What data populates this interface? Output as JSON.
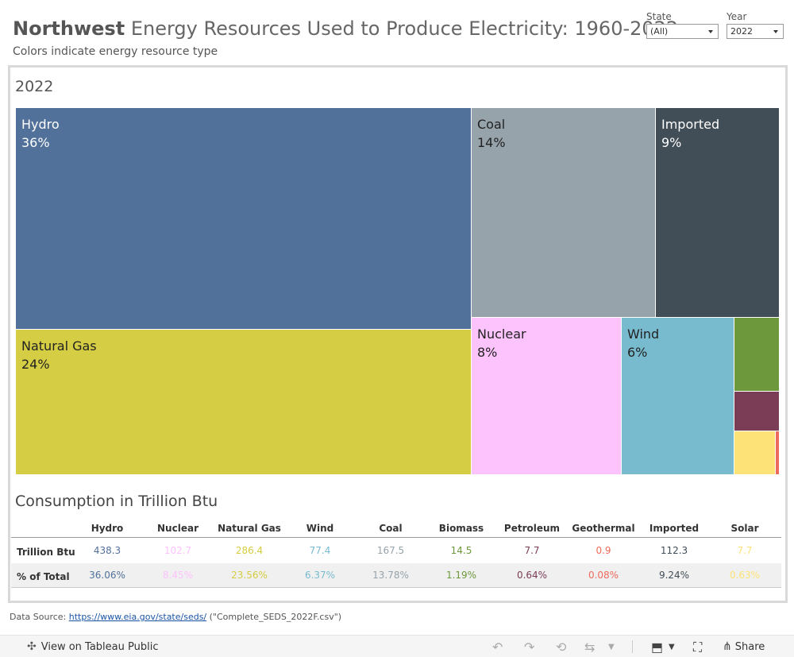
{
  "header": {
    "title_bold": "Northwest",
    "title_rest": " Energy Resources Used to Produce Electricity: 1960-2022",
    "subtitle": "Colors indicate energy resource type"
  },
  "filters": {
    "state_label": "State",
    "state_value": "(All)",
    "year_label": "Year",
    "year_value": "2022"
  },
  "chart_data": {
    "type": "treemap",
    "title": "2022",
    "tiles": [
      {
        "name": "Hydro",
        "label": "Hydro",
        "pct": "36%",
        "value": 438.3,
        "color": "#52719a"
      },
      {
        "name": "Natural Gas",
        "label": "Natural Gas",
        "pct": "24%",
        "value": 286.4,
        "color": "#d5cd43"
      },
      {
        "name": "Coal",
        "label": "Coal",
        "pct": "14%",
        "value": 167.5,
        "color": "#96a3aa"
      },
      {
        "name": "Imported",
        "label": "Imported",
        "pct": "9%",
        "value": 112.3,
        "color": "#414d57"
      },
      {
        "name": "Nuclear",
        "label": "Nuclear",
        "pct": "8%",
        "value": 102.7,
        "color": "#fdc3fc"
      },
      {
        "name": "Wind",
        "label": "Wind",
        "pct": "6%",
        "value": 77.4,
        "color": "#78bbcf"
      },
      {
        "name": "Biomass",
        "label": "",
        "pct": "",
        "value": 14.5,
        "color": "#6d993c"
      },
      {
        "name": "Petroleum",
        "label": "",
        "pct": "",
        "value": 7.7,
        "color": "#7b3c55"
      },
      {
        "name": "Solar",
        "label": "",
        "pct": "",
        "value": 7.7,
        "color": "#fde377"
      },
      {
        "name": "Geothermal",
        "label": "",
        "pct": "",
        "value": 0.9,
        "color": "#ee6a5b"
      }
    ]
  },
  "table": {
    "title": "Consumption in Trillion Btu",
    "columns": [
      "Hydro",
      "Nuclear",
      "Natural Gas",
      "Wind",
      "Coal",
      "Biomass",
      "Petroleum",
      "Geothermal",
      "Imported",
      "Solar"
    ],
    "column_colors": [
      "#52719a",
      "#fdc3fc",
      "#d5cd43",
      "#78bbcf",
      "#96a3aa",
      "#6d993c",
      "#7b3c55",
      "#ee6a5b",
      "#414d57",
      "#fde377"
    ],
    "rows": [
      {
        "label": "Trillion Btu",
        "values": [
          "438.3",
          "102.7",
          "286.4",
          "77.4",
          "167.5",
          "14.5",
          "7.7",
          "0.9",
          "112.3",
          "7.7"
        ]
      },
      {
        "label": "% of Total",
        "values": [
          "36.06%",
          "8.45%",
          "23.56%",
          "6.37%",
          "13.78%",
          "1.19%",
          "0.64%",
          "0.08%",
          "9.24%",
          "0.63%"
        ]
      }
    ]
  },
  "source": {
    "prefix": "Data Source: ",
    "link_text": "https://www.eia.gov/state/seds/",
    "suffix": " (\"Complete_SEDS_2022F.csv\")"
  },
  "toolbar": {
    "view_label": "View on Tableau Public",
    "share_label": "Share"
  }
}
